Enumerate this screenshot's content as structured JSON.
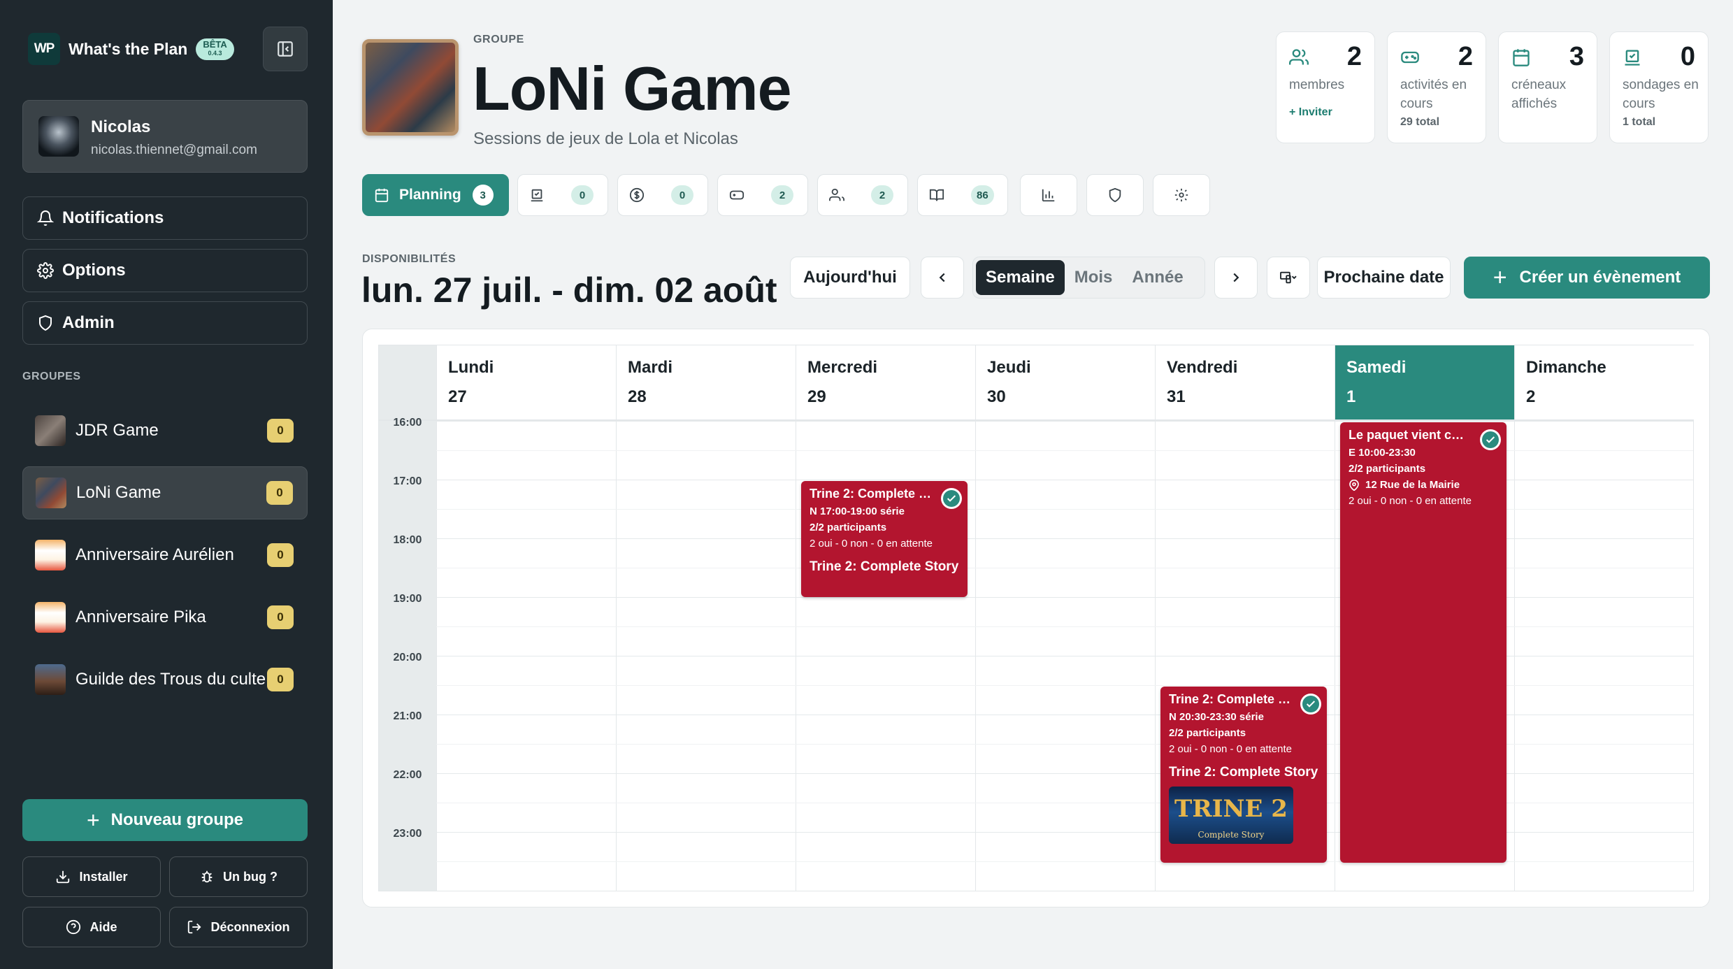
{
  "app": {
    "logo_text": "WP",
    "name": "What's the Plan",
    "beta_label": "BÊTA",
    "version": "0.4.3"
  },
  "user": {
    "name": "Nicolas",
    "email": "nicolas.thiennet@gmail.com"
  },
  "nav": {
    "notifications": "Notifications",
    "options": "Options",
    "admin": "Admin"
  },
  "groups": {
    "title": "GROUPES",
    "items": [
      {
        "name": "JDR Game",
        "count": "0"
      },
      {
        "name": "LoNi Game",
        "count": "0"
      },
      {
        "name": "Anniversaire Aurélien",
        "count": "0"
      },
      {
        "name": "Anniversaire Pika",
        "count": "0"
      },
      {
        "name": "Guilde des Trous du culte",
        "count": "0"
      }
    ]
  },
  "sidebar_footer": {
    "new_group": "Nouveau groupe",
    "install": "Installer",
    "bug": "Un bug ?",
    "help": "Aide",
    "logout": "Déconnexion"
  },
  "header": {
    "overline": "GROUPE",
    "title": "LoNi Game",
    "subtitle": "Sessions de jeux de Lola et Nicolas"
  },
  "stats": [
    {
      "icon": "users-icon",
      "value": "2",
      "label": "membres",
      "extra": "+ Inviter"
    },
    {
      "icon": "gamepad-icon",
      "value": "2",
      "label": "activités en cours",
      "extra": "29 total"
    },
    {
      "icon": "calendar-icon",
      "value": "3",
      "label": "créneaux affichés",
      "extra": ""
    },
    {
      "icon": "vote-icon",
      "value": "0",
      "label": "sondages en cours",
      "extra": "1 total"
    }
  ],
  "tabs": [
    {
      "label": "Planning",
      "count": "3",
      "icon": "calendar-icon"
    },
    {
      "label": "",
      "count": "0",
      "icon": "vote-icon"
    },
    {
      "label": "",
      "count": "0",
      "icon": "dollar-icon"
    },
    {
      "label": "",
      "count": "2",
      "icon": "gamepad-icon"
    },
    {
      "label": "",
      "count": "2",
      "icon": "users-icon"
    },
    {
      "label": "",
      "count": "86",
      "icon": "book-icon"
    },
    {
      "label": "",
      "count": "",
      "icon": "bar-chart-icon"
    },
    {
      "label": "",
      "count": "",
      "icon": "shield-icon"
    },
    {
      "label": "",
      "count": "",
      "icon": "gear-icon"
    }
  ],
  "planning": {
    "overline": "DISPONIBILITÉS",
    "range": "lun. 27 juil. - dim. 02 août",
    "today": "Aujourd'hui",
    "views": [
      "Semaine",
      "Mois",
      "Année"
    ],
    "selected_view": "Semaine",
    "next_date": "Prochaine date",
    "create": "Créer un évènement"
  },
  "calendar": {
    "days": [
      {
        "name": "Lundi",
        "date": "27"
      },
      {
        "name": "Mardi",
        "date": "28"
      },
      {
        "name": "Mercredi",
        "date": "29"
      },
      {
        "name": "Jeudi",
        "date": "30"
      },
      {
        "name": "Vendredi",
        "date": "31"
      },
      {
        "name": "Samedi",
        "date": "1"
      },
      {
        "name": "Dimanche",
        "date": "2"
      }
    ],
    "today_index": 5,
    "hours": [
      "16:00",
      "17:00",
      "18:00",
      "19:00",
      "20:00",
      "21:00",
      "22:00",
      "23:00"
    ],
    "events": [
      {
        "title": "Trine 2: Complete Story",
        "time": "N 17:00-19:00 série",
        "participants": "2/2 participants",
        "votes": "2 oui - 0 non - 0 en attente",
        "game": "Trine 2: Complete Story"
      },
      {
        "title": "Trine 2: Complete Story",
        "time": "N 20:30-23:30 série",
        "participants": "2/2 participants",
        "votes": "2 oui - 0 non - 0 en attente",
        "game": "Trine 2: Complete Story",
        "image_title": "TRINE 2",
        "image_subtitle": "Complete Story"
      },
      {
        "title": "Le paquet vient chez",
        "time": "E 10:00-23:30",
        "participants": "2/2 participants",
        "location": "12 Rue de la Mairie",
        "votes": "2 oui - 0 non - 0 en attente"
      }
    ]
  },
  "colors": {
    "sidebar_bg": "#1f282e",
    "accent": "#2a8a7e",
    "event": "#b3152f",
    "badge": "#e7cf72"
  }
}
